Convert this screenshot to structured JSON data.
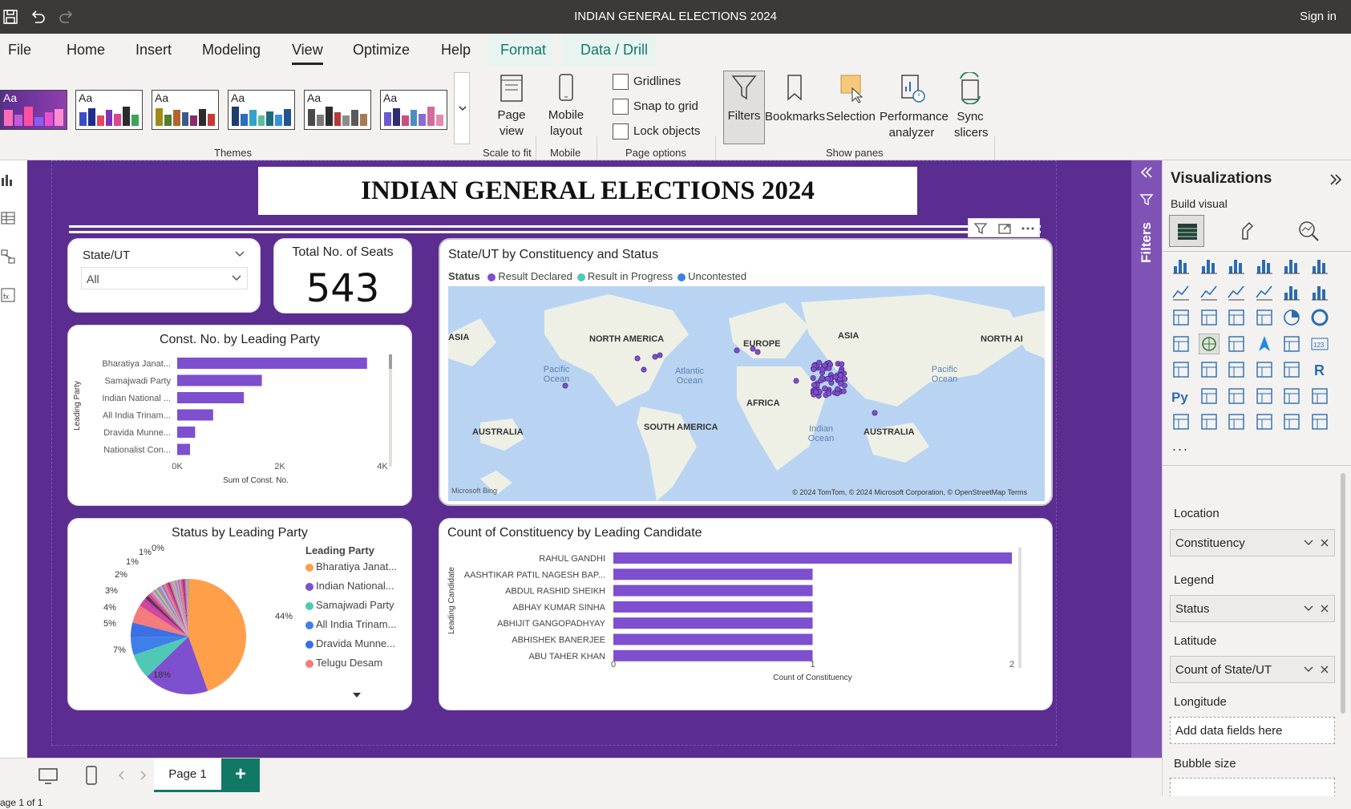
{
  "titlebar": {
    "title": "INDIAN GENERAL ELECTIONS 2024",
    "signin": "Sign in"
  },
  "menu": [
    "File",
    "Home",
    "Insert",
    "Modeling",
    "View",
    "Optimize",
    "Help",
    "Format",
    "Data / Drill"
  ],
  "ribbon": {
    "themes_label": "Themes",
    "theme_aa": "Aa",
    "page_view": "Page view",
    "scale_to_fit": "Scale to fit",
    "mobile_layout": "Mobile layout",
    "mobile": "Mobile",
    "gridlines": "Gridlines",
    "snap_to_grid": "Snap to grid",
    "lock_objects": "Lock objects",
    "page_options": "Page options",
    "filters": "Filters",
    "bookmarks": "Bookmarks",
    "selection": "Selection",
    "performance_analyzer": "Performance analyzer",
    "sync_slicers": "Sync slicers",
    "show_panes": "Show panes"
  },
  "report": {
    "title": "INDIAN GENERAL ELECTIONS 2024",
    "slicer": {
      "label": "State/UT",
      "value": "All"
    },
    "card": {
      "label": "Total No. of Seats",
      "value": "543"
    }
  },
  "bar_party": {
    "title": "Const. No. by Leading Party",
    "ylabel": "Leading Party",
    "xlabel": "Sum of Const. No.",
    "categories": [
      "Bharatiya Janat...",
      "Samajwadi Party",
      "Indian National ...",
      "All India Trinam...",
      "Dravida Munne...",
      "Nationalist Con..."
    ],
    "values": [
      3700,
      1650,
      1300,
      700,
      350,
      250
    ],
    "ticks": [
      "0K",
      "2K",
      "4K"
    ],
    "xmax": 4000
  },
  "pie": {
    "title": "Status by Leading Party",
    "legend_title": "Leading Party",
    "legend": [
      {
        "name": "Bharatiya Janat...",
        "color": "#ff9f4a"
      },
      {
        "name": "Indian National...",
        "color": "#7e4fce"
      },
      {
        "name": "Samajwadi Party",
        "color": "#4fc9b6"
      },
      {
        "name": "All India Trinam...",
        "color": "#3f7fe8"
      },
      {
        "name": "Dravida Munne...",
        "color": "#3b6fe6"
      },
      {
        "name": "Telugu Desam",
        "color": "#f47b7b"
      }
    ],
    "labels": [
      "44%",
      "18%",
      "7%",
      "5%",
      "4%",
      "3%",
      "2%",
      "1%",
      "1%",
      "0%"
    ]
  },
  "map": {
    "title": "State/UT by Constituency and Status",
    "legend_title": "Status",
    "legend": [
      {
        "name": "Result Declared",
        "color": "#7e4fce"
      },
      {
        "name": "Result in Progress",
        "color": "#4fc9b6"
      },
      {
        "name": "Uncontested",
        "color": "#3f7fe8"
      }
    ],
    "continents": [
      "ASIA",
      "NORTH AMERICA",
      "EUROPE",
      "ASIA",
      "NORTH AI",
      "AFRICA",
      "SOUTH AMERICA",
      "AUSTRALIA",
      "AUSTRALIA"
    ],
    "oceans": [
      "Pacific Ocean",
      "Atlantic Ocean",
      "Pacific Ocean",
      "Indian Ocean"
    ],
    "copyright": "© 2024 TomTom, © 2024 Microsoft Corporation, © OpenStreetMap  Terms",
    "bing": "Microsoft Bing"
  },
  "bar_candidate": {
    "title": "Count of Constituency by Leading Candidate",
    "ylabel": "Leading Candidate",
    "xlabel": "Count of Constituency",
    "categories": [
      "RAHUL GANDHI",
      "AASHTIKAR PATIL NAGESH BAP...",
      "ABDUL RASHID SHEIKH",
      "ABHAY KUMAR SINHA",
      "ABHIJIT GANGOPADHYAY",
      "ABHISHEK BANERJEE",
      "ABU TAHER KHAN"
    ],
    "values": [
      2,
      1,
      1,
      1,
      1,
      1,
      1
    ],
    "ticks": [
      "0",
      "1",
      "2"
    ],
    "xmax": 2
  },
  "chart_data": [
    {
      "type": "bar",
      "title": "Const. No. by Leading Party",
      "categories": [
        "Bharatiya Janat...",
        "Samajwadi Party",
        "Indian National ...",
        "All India Trinam...",
        "Dravida Munne...",
        "Nationalist Con..."
      ],
      "values": [
        3700,
        1650,
        1300,
        700,
        350,
        250
      ],
      "xlabel": "Sum of Const. No.",
      "ylabel": "Leading Party",
      "xlim": [
        0,
        4000
      ]
    },
    {
      "type": "pie",
      "title": "Status by Leading Party",
      "categories": [
        "Bharatiya Janat...",
        "Indian National...",
        "Samajwadi Party",
        "All India Trinam...",
        "Dravida Munne...",
        "Telugu Desam"
      ],
      "values": [
        44,
        18,
        7,
        5,
        4,
        3
      ]
    },
    {
      "type": "bar",
      "title": "Count of Constituency by Leading Candidate",
      "categories": [
        "RAHUL GANDHI",
        "AASHTIKAR PATIL NAGESH BAP...",
        "ABDUL RASHID SHEIKH",
        "ABHAY KUMAR SINHA",
        "ABHIJIT GANGOPADHYAY",
        "ABHISHEK BANERJEE",
        "ABU TAHER KHAN"
      ],
      "values": [
        2,
        1,
        1,
        1,
        1,
        1,
        1
      ],
      "xlabel": "Count of Constituency",
      "ylabel": "Leading Candidate",
      "xlim": [
        0,
        2
      ]
    }
  ],
  "filters_pane": {
    "label": "Filters"
  },
  "viz": {
    "title": "Visualizations",
    "build_visual": "Build visual",
    "wells": [
      {
        "label": "Location",
        "value": "Constituency"
      },
      {
        "label": "Legend",
        "value": "Status"
      },
      {
        "label": "Latitude",
        "value": "Count of State/UT"
      },
      {
        "label": "Longitude",
        "value": "Add data fields here"
      },
      {
        "label": "Bubble size",
        "value": ""
      }
    ]
  },
  "tabs": {
    "page1": "Page 1",
    "add": "+"
  },
  "status": {
    "page": "age 1 of 1"
  }
}
